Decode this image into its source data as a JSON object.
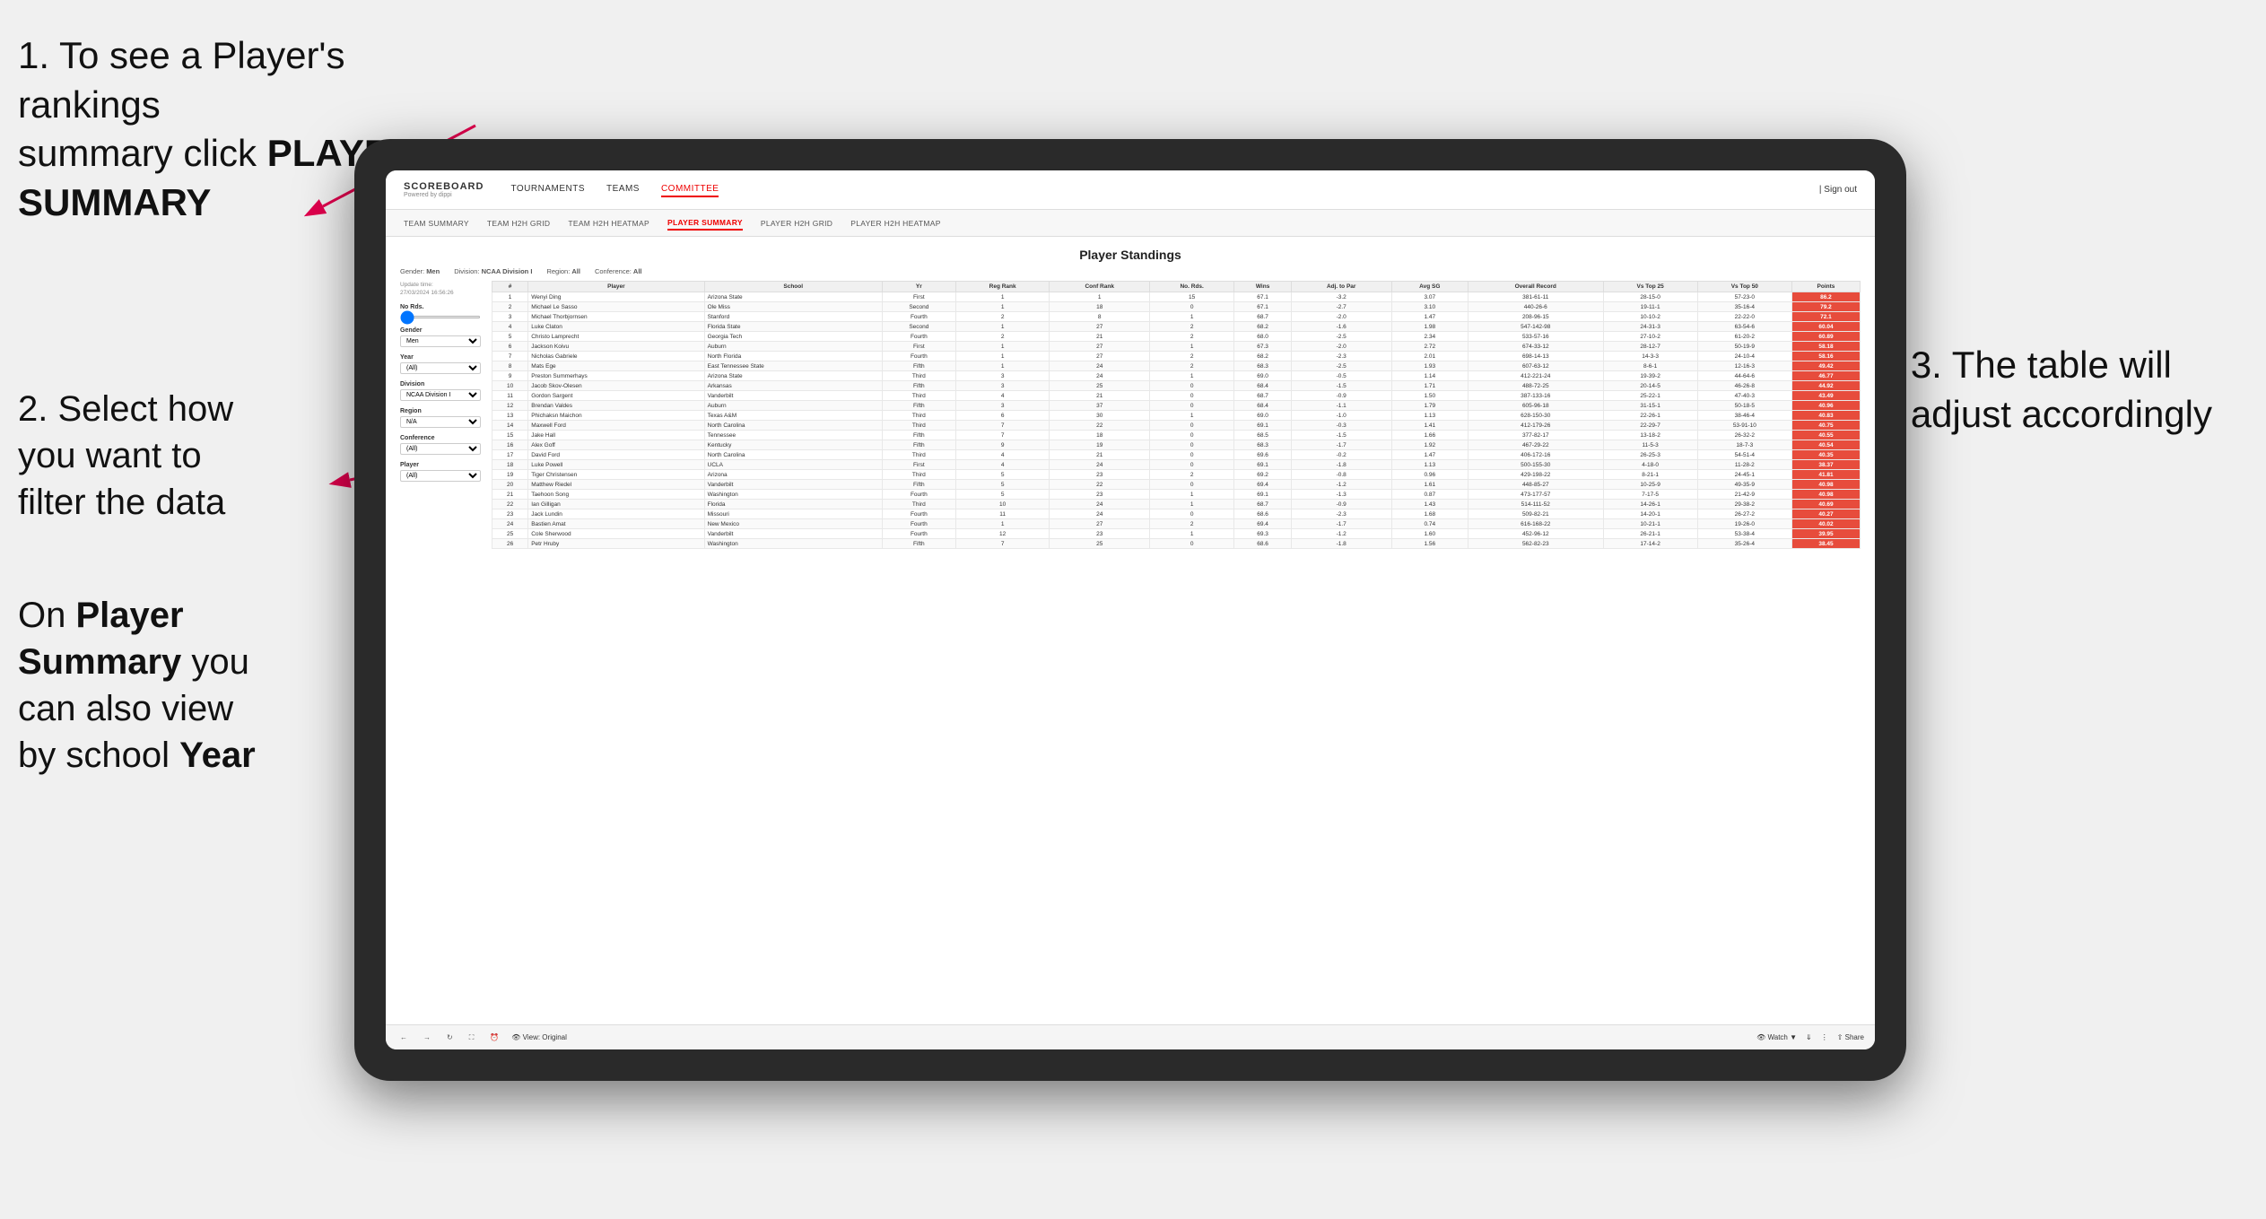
{
  "annotations": {
    "ann1_line1": "1. To see a Player's rankings",
    "ann1_line2": "summary click ",
    "ann1_bold": "PLAYER SUMMARY",
    "ann2_line1": "2. Select how",
    "ann2_line2": "you want to",
    "ann2_line3": "filter the data",
    "ann3_line1": "3. The table will",
    "ann3_line2": "adjust accordingly",
    "ann4_line1": "On ",
    "ann4_bold1": "Player",
    "ann4_line2": "Summary",
    "ann4_line3": " you",
    "ann4_line4": "can also view",
    "ann4_line5": "by school ",
    "ann4_bold2": "Year"
  },
  "nav": {
    "logo": "SCOREBOARD",
    "logo_sub": "Powered by dippi",
    "items": [
      "TOURNAMENTS",
      "TEAMS",
      "COMMITTEE"
    ],
    "active": "COMMITTEE",
    "right": [
      "| Sign out"
    ]
  },
  "subnav": {
    "items": [
      "TEAM SUMMARY",
      "TEAM H2H GRID",
      "TEAM H2H HEATMAP",
      "PLAYER SUMMARY",
      "PLAYER H2H GRID",
      "PLAYER H2H HEATMAP"
    ],
    "active": "PLAYER SUMMARY"
  },
  "page": {
    "title": "Player Standings",
    "update_time": "Update time:\n27/03/2024 16:56:26",
    "filters": {
      "gender_label": "Gender:",
      "gender_value": "Men",
      "division_label": "Division:",
      "division_value": "NCAA Division I",
      "region_label": "Region:",
      "region_value": "All",
      "conference_label": "Conference:",
      "conference_value": "All"
    },
    "left_filters": {
      "no_rds_label": "No Rds.",
      "gender_label": "Gender",
      "gender_option": "Men",
      "year_label": "Year",
      "year_option": "(All)",
      "division_label": "Division",
      "division_option": "NCAA Division I",
      "region_label": "Region",
      "region_option": "N/A",
      "conference_label": "Conference",
      "conference_option": "(All)",
      "player_label": "Player",
      "player_option": "(All)"
    },
    "table": {
      "headers": [
        "#",
        "Player",
        "School",
        "Yr",
        "Reg Rank",
        "Conf Rank",
        "No. Rds.",
        "Wins",
        "Adj. to Par",
        "Avg SG",
        "Overall Record",
        "Vs Top 25",
        "Vs Top 50",
        "Points"
      ],
      "rows": [
        [
          "1",
          "Wenyi Ding",
          "Arizona State",
          "First",
          "1",
          "1",
          "15",
          "67.1",
          "-3.2",
          "3.07",
          "381-61-11",
          "28-15-0",
          "57-23-0",
          "86.2"
        ],
        [
          "2",
          "Michael Le Sasso",
          "Ole Miss",
          "Second",
          "1",
          "18",
          "0",
          "67.1",
          "-2.7",
          "3.10",
          "440-26-6",
          "19-11-1",
          "35-16-4",
          "79.2"
        ],
        [
          "3",
          "Michael Thorbjornsen",
          "Stanford",
          "Fourth",
          "2",
          "8",
          "1",
          "68.7",
          "-2.0",
          "1.47",
          "208-96-15",
          "10-10-2",
          "22-22-0",
          "72.1"
        ],
        [
          "4",
          "Luke Claton",
          "Florida State",
          "Second",
          "1",
          "27",
          "2",
          "68.2",
          "-1.6",
          "1.98",
          "547-142-98",
          "24-31-3",
          "63-54-6",
          "60.04"
        ],
        [
          "5",
          "Christo Lamprecht",
          "Georgia Tech",
          "Fourth",
          "2",
          "21",
          "2",
          "68.0",
          "-2.5",
          "2.34",
          "533-57-16",
          "27-10-2",
          "61-20-2",
          "60.89"
        ],
        [
          "6",
          "Jackson Koivu",
          "Auburn",
          "First",
          "1",
          "27",
          "1",
          "67.3",
          "-2.0",
          "2.72",
          "674-33-12",
          "28-12-7",
          "50-19-9",
          "58.18"
        ],
        [
          "7",
          "Nicholas Gabriele",
          "North Florida",
          "Fourth",
          "1",
          "27",
          "2",
          "68.2",
          "-2.3",
          "2.01",
          "698-14-13",
          "14-3-3",
          "24-10-4",
          "58.16"
        ],
        [
          "8",
          "Mats Ege",
          "East Tennessee State",
          "Fifth",
          "1",
          "24",
          "2",
          "68.3",
          "-2.5",
          "1.93",
          "607-63-12",
          "8-6-1",
          "12-16-3",
          "49.42"
        ],
        [
          "9",
          "Preston Summerhays",
          "Arizona State",
          "Third",
          "3",
          "24",
          "1",
          "69.0",
          "-0.5",
          "1.14",
          "412-221-24",
          "19-39-2",
          "44-64-6",
          "46.77"
        ],
        [
          "10",
          "Jacob Skov-Olesen",
          "Arkansas",
          "Fifth",
          "3",
          "25",
          "0",
          "68.4",
          "-1.5",
          "1.71",
          "488-72-25",
          "20-14-5",
          "46-26-8",
          "44.92"
        ],
        [
          "11",
          "Gordon Sargent",
          "Vanderbilt",
          "Third",
          "4",
          "21",
          "0",
          "68.7",
          "-0.9",
          "1.50",
          "387-133-16",
          "25-22-1",
          "47-40-3",
          "43.49"
        ],
        [
          "12",
          "Brendan Valdes",
          "Auburn",
          "Fifth",
          "3",
          "37",
          "0",
          "68.4",
          "-1.1",
          "1.79",
          "605-96-18",
          "31-15-1",
          "50-18-5",
          "40.96"
        ],
        [
          "13",
          "Phichaksn Maichon",
          "Texas A&M",
          "Third",
          "6",
          "30",
          "1",
          "69.0",
          "-1.0",
          "1.13",
          "628-150-30",
          "22-26-1",
          "38-46-4",
          "40.83"
        ],
        [
          "14",
          "Maxwell Ford",
          "North Carolina",
          "Third",
          "7",
          "22",
          "0",
          "69.1",
          "-0.3",
          "1.41",
          "412-179-26",
          "22-29-7",
          "53-91-10",
          "40.75"
        ],
        [
          "15",
          "Jake Hall",
          "Tennessee",
          "Fifth",
          "7",
          "18",
          "0",
          "68.5",
          "-1.5",
          "1.66",
          "377-82-17",
          "13-18-2",
          "26-32-2",
          "40.55"
        ],
        [
          "16",
          "Alex Goff",
          "Kentucky",
          "Fifth",
          "9",
          "19",
          "0",
          "68.3",
          "-1.7",
          "1.92",
          "467-29-22",
          "11-5-3",
          "18-7-3",
          "40.54"
        ],
        [
          "17",
          "David Ford",
          "North Carolina",
          "Third",
          "4",
          "21",
          "0",
          "69.6",
          "-0.2",
          "1.47",
          "406-172-16",
          "26-25-3",
          "54-51-4",
          "40.35"
        ],
        [
          "18",
          "Luke Powell",
          "UCLA",
          "First",
          "4",
          "24",
          "0",
          "69.1",
          "-1.8",
          "1.13",
          "500-155-30",
          "4-18-0",
          "11-28-2",
          "38.37"
        ],
        [
          "19",
          "Tiger Christensen",
          "Arizona",
          "Third",
          "5",
          "23",
          "2",
          "69.2",
          "-0.8",
          "0.96",
          "429-198-22",
          "8-21-1",
          "24-45-1",
          "41.81"
        ],
        [
          "20",
          "Matthew Riedel",
          "Vanderbilt",
          "Fifth",
          "5",
          "22",
          "0",
          "69.4",
          "-1.2",
          "1.61",
          "448-85-27",
          "10-25-9",
          "49-35-9",
          "40.98"
        ],
        [
          "21",
          "Taehoon Song",
          "Washington",
          "Fourth",
          "5",
          "23",
          "1",
          "69.1",
          "-1.3",
          "0.87",
          "473-177-57",
          "7-17-5",
          "21-42-9",
          "40.98"
        ],
        [
          "22",
          "Ian Gilligan",
          "Florida",
          "Third",
          "10",
          "24",
          "1",
          "68.7",
          "-0.9",
          "1.43",
          "514-111-52",
          "14-26-1",
          "29-38-2",
          "40.69"
        ],
        [
          "23",
          "Jack Lundin",
          "Missouri",
          "Fourth",
          "11",
          "24",
          "0",
          "68.6",
          "-2.3",
          "1.68",
          "509-82-21",
          "14-20-1",
          "26-27-2",
          "40.27"
        ],
        [
          "24",
          "Bastien Amat",
          "New Mexico",
          "Fourth",
          "1",
          "27",
          "2",
          "69.4",
          "-1.7",
          "0.74",
          "616-168-22",
          "10-21-1",
          "19-26-0",
          "40.02"
        ],
        [
          "25",
          "Cole Sherwood",
          "Vanderbilt",
          "Fourth",
          "12",
          "23",
          "1",
          "69.3",
          "-1.2",
          "1.60",
          "452-96-12",
          "26-21-1",
          "53-38-4",
          "39.95"
        ],
        [
          "26",
          "Petr Hruby",
          "Washington",
          "Fifth",
          "7",
          "25",
          "0",
          "68.6",
          "-1.8",
          "1.56",
          "562-82-23",
          "17-14-2",
          "35-26-4",
          "38.45"
        ]
      ]
    },
    "toolbar": {
      "view_label": "View: Original",
      "watch_label": "Watch",
      "share_label": "Share"
    }
  }
}
